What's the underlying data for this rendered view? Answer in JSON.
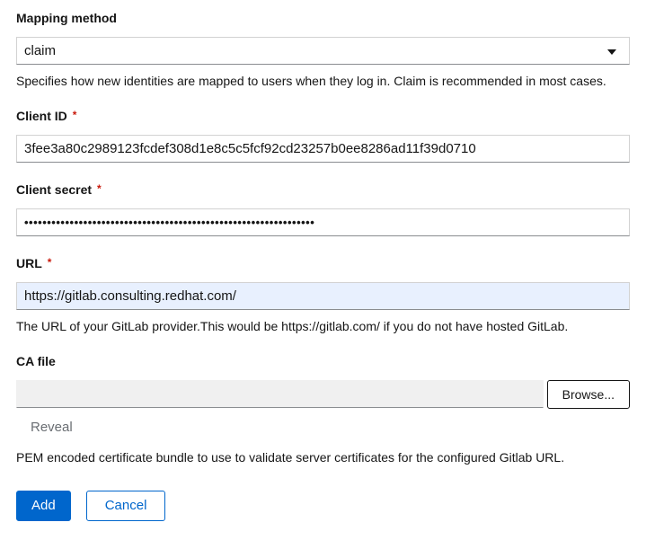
{
  "form": {
    "required_marker": "*",
    "mapping_method": {
      "label": "Mapping method",
      "selected_value": "claim",
      "helper": "Specifies how new identities are mapped to users when they log in. Claim is recommended in most cases."
    },
    "client_id": {
      "label": "Client ID",
      "value": "3fee3a80c2989123fcdef308d1e8c5c5fcf92cd23257b0ee8286ad11f39d0710"
    },
    "client_secret": {
      "label": "Client secret",
      "masked_value": "••••••••••••••••••••••••••••••••••••••••••••••••••••••••••••••••"
    },
    "url": {
      "label": "URL",
      "value": "https://gitlab.consulting.redhat.com/",
      "helper": "The URL of your GitLab provider.This would be https://gitlab.com/ if you do not have hosted GitLab."
    },
    "ca_file": {
      "label": "CA file",
      "filename_value": "",
      "browse_label": "Browse...",
      "reveal_label": "Reveal",
      "helper": "PEM encoded certificate bundle to use to validate server certificates for the configured Gitlab URL."
    },
    "actions": {
      "add_label": "Add",
      "cancel_label": "Cancel"
    }
  },
  "colors": {
    "primary_blue": "#0066cc",
    "danger_red": "#c9190b",
    "text": "#151515",
    "muted_text": "#6a6e73",
    "input_bottom_border": "#8a8d90",
    "autofill_bg": "#e8f0fe",
    "disabled_bg": "#f0f0f0"
  }
}
